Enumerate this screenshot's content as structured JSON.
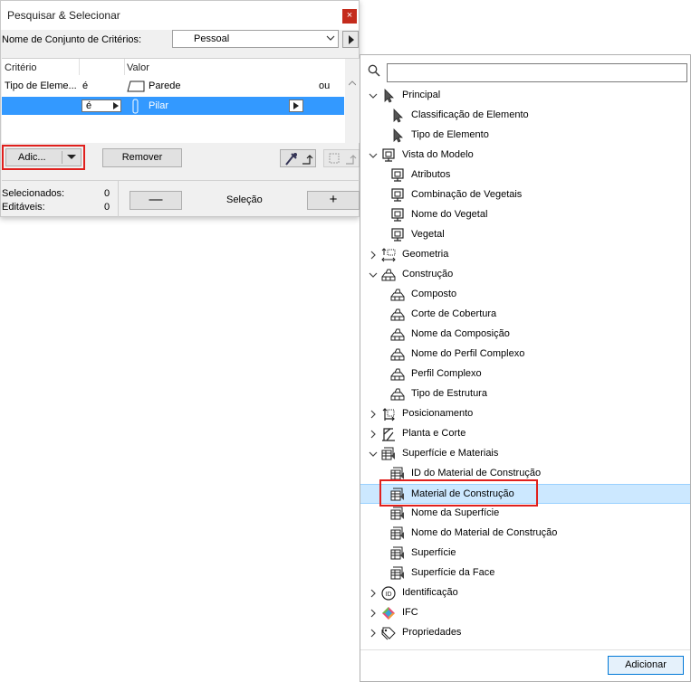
{
  "dialog": {
    "title": "Pesquisar & Selecionar",
    "close_glyph": "×",
    "criteria_set_label": "Nome de Conjunto de Critérios:",
    "criteria_set_value": "Pessoal",
    "table": {
      "headers": [
        "Critério",
        "Valor"
      ],
      "rows": [
        {
          "criterion": "Tipo de Eleme...",
          "operator": "é",
          "value": "Parede",
          "suffix": "ou",
          "icon": "wall-icon"
        },
        {
          "criterion": "",
          "operator": "é",
          "value": "Pilar",
          "suffix": "",
          "icon": "column-icon"
        }
      ]
    },
    "add_label": "Adic...",
    "remove_label": "Remover",
    "selected_label": "Selecionados:",
    "selected_count": "0",
    "editable_label": "Editáveis:",
    "editable_count": "0",
    "minus_label": "—",
    "selection_label": "Seleção",
    "plus_label": "+"
  },
  "panel": {
    "search_placeholder": "",
    "items": [
      {
        "label": "Principal",
        "level": 0,
        "expanded": true,
        "icon": "cursor-icon"
      },
      {
        "label": "Classificação de Elemento",
        "level": 1,
        "icon": "cursor-icon"
      },
      {
        "label": "Tipo de Elemento",
        "level": 1,
        "icon": "cursor-icon"
      },
      {
        "label": "Vista do Modelo",
        "level": 0,
        "expanded": true,
        "icon": "model-view-icon"
      },
      {
        "label": "Atributos",
        "level": 1,
        "icon": "model-view-icon"
      },
      {
        "label": "Combinação de Vegetais",
        "level": 1,
        "icon": "model-view-icon"
      },
      {
        "label": "Nome do Vegetal",
        "level": 1,
        "icon": "model-view-icon"
      },
      {
        "label": "Vegetal",
        "level": 1,
        "icon": "model-view-icon"
      },
      {
        "label": "Geometria",
        "level": 0,
        "expanded": false,
        "icon": "geometry-icon"
      },
      {
        "label": "Construção",
        "level": 0,
        "expanded": true,
        "icon": "bricks-icon"
      },
      {
        "label": "Composto",
        "level": 1,
        "icon": "bricks-icon"
      },
      {
        "label": "Corte de Cobertura",
        "level": 1,
        "icon": "bricks-icon"
      },
      {
        "label": "Nome da Composição",
        "level": 1,
        "icon": "bricks-icon"
      },
      {
        "label": "Nome do Perfil Complexo",
        "level": 1,
        "icon": "bricks-icon"
      },
      {
        "label": "Perfil Complexo",
        "level": 1,
        "icon": "bricks-icon"
      },
      {
        "label": "Tipo de Estrutura",
        "level": 1,
        "icon": "bricks-icon"
      },
      {
        "label": "Posicionamento",
        "level": 0,
        "expanded": false,
        "icon": "positioning-icon"
      },
      {
        "label": "Planta e Corte",
        "level": 0,
        "expanded": false,
        "icon": "plan-section-icon"
      },
      {
        "label": "Superfície e Materiais",
        "level": 0,
        "expanded": true,
        "icon": "materials-icon"
      },
      {
        "label": "ID do Material de Construção",
        "level": 1,
        "icon": "materials-icon"
      },
      {
        "label": "Material de Construção",
        "level": 1,
        "icon": "materials-icon",
        "selected": true
      },
      {
        "label": "Nome da Superfície",
        "level": 1,
        "icon": "materials-icon"
      },
      {
        "label": "Nome do Material de Construção",
        "level": 1,
        "icon": "materials-icon"
      },
      {
        "label": "Superfície",
        "level": 1,
        "icon": "materials-icon"
      },
      {
        "label": "Superfície da Face",
        "level": 1,
        "icon": "materials-icon"
      },
      {
        "label": "Identificação",
        "level": 0,
        "expanded": false,
        "icon": "id-icon"
      },
      {
        "label": "IFC",
        "level": 0,
        "expanded": false,
        "icon": "ifc-icon"
      },
      {
        "label": "Propriedades",
        "level": 0,
        "expanded": false,
        "icon": "tag-icon"
      }
    ],
    "add_button_label": "Adicionar"
  },
  "colors": {
    "selected_row": "#3399ff",
    "tree_highlight": "#cce8ff",
    "callout_red": "#e0201d",
    "close_red": "#c42b1c"
  }
}
